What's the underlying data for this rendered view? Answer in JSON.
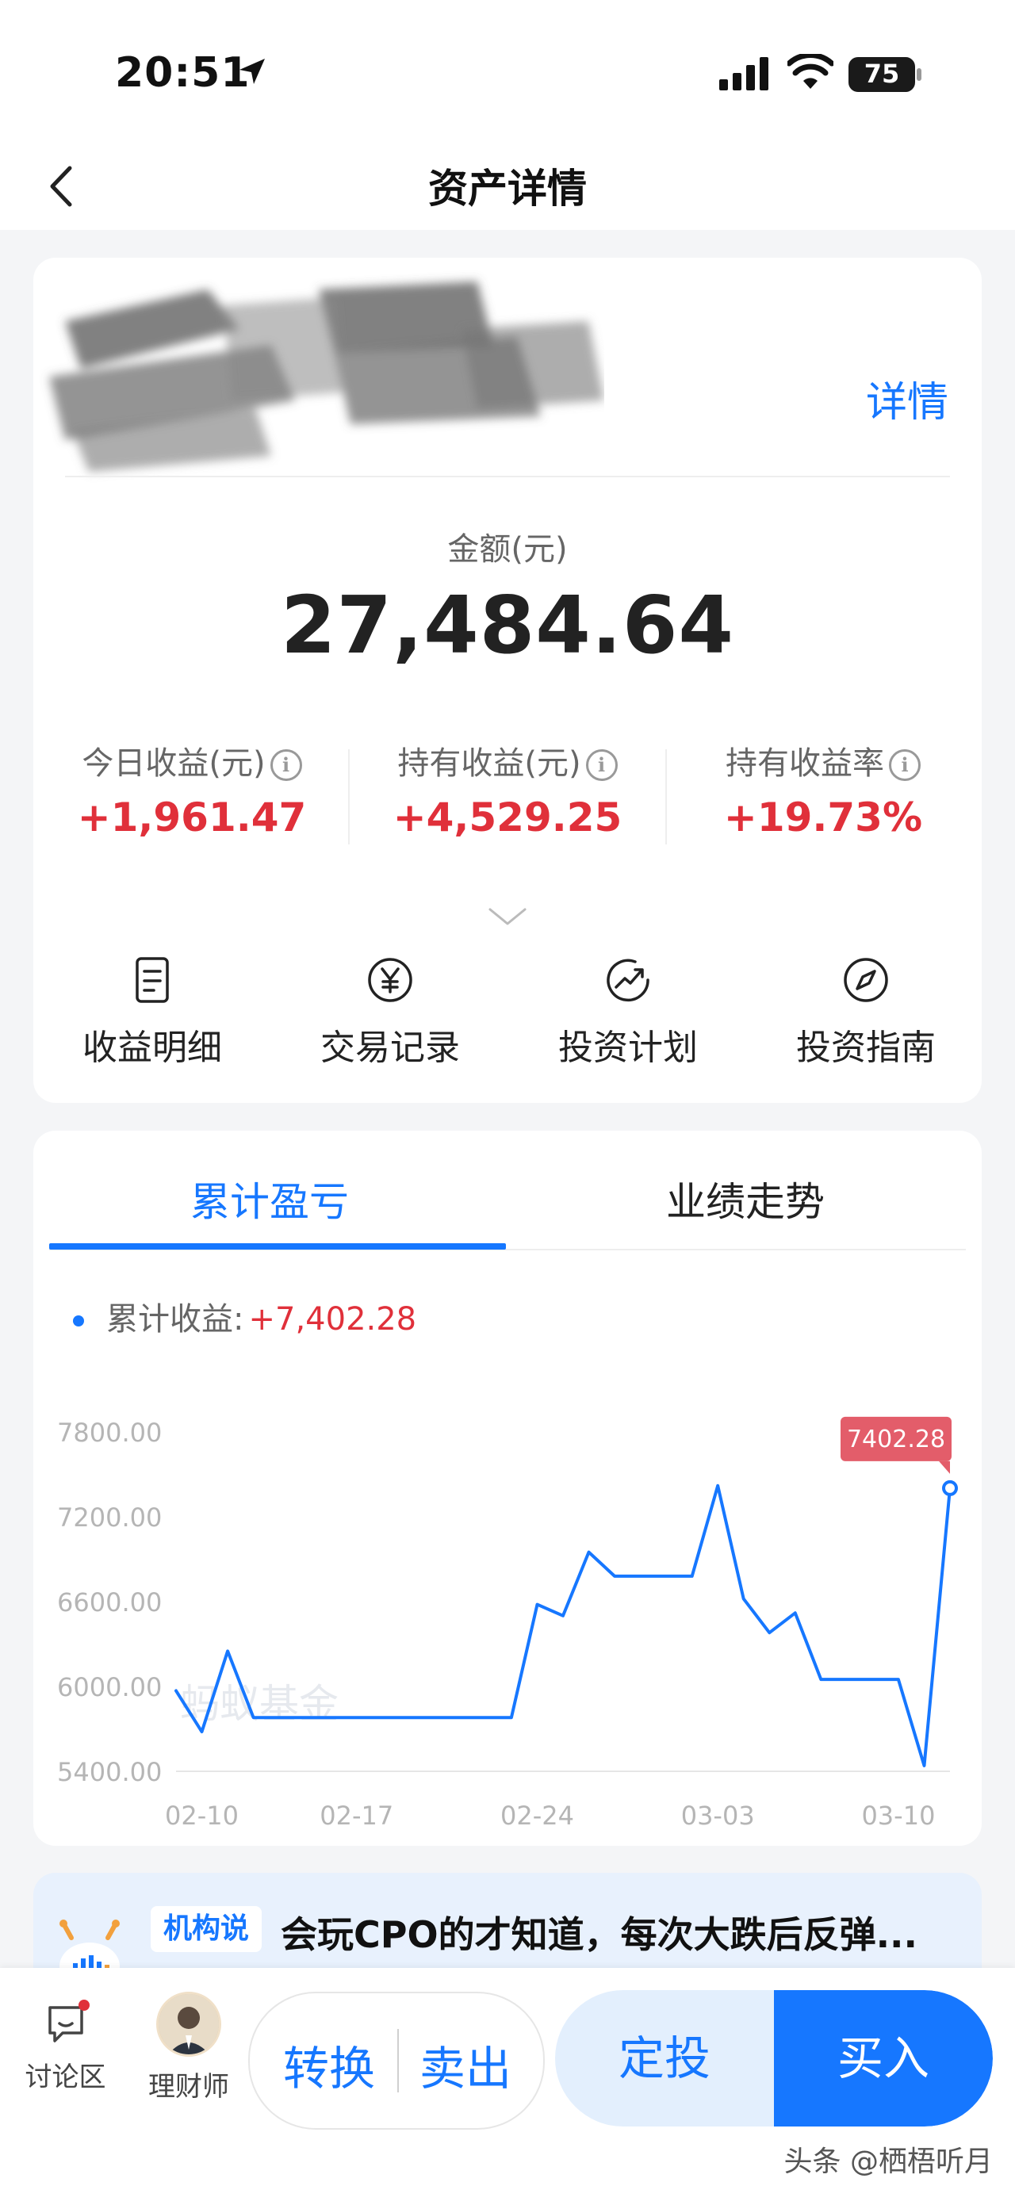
{
  "status_bar": {
    "time": "20:51",
    "battery": "75"
  },
  "nav": {
    "title": "资产详情",
    "back_icon": "chevron-left-icon"
  },
  "asset": {
    "detail_link": "详情",
    "amount_label": "金额(元)",
    "amount": "27,484.64",
    "stats": [
      {
        "label": "今日收益(元)",
        "value": "+1,961.47"
      },
      {
        "label": "持有收益(元)",
        "value": "+4,529.25"
      },
      {
        "label": "持有收益率",
        "value": "+19.73%"
      }
    ],
    "quick_actions": [
      {
        "label": "收益明细",
        "icon": "document-icon"
      },
      {
        "label": "交易记录",
        "icon": "yen-circle-icon"
      },
      {
        "label": "投资计划",
        "icon": "trend-circle-icon"
      },
      {
        "label": "投资指南",
        "icon": "compass-icon"
      }
    ]
  },
  "performance": {
    "tabs": [
      "累计盈亏",
      "业绩走势"
    ],
    "active_tab": 0,
    "legend_label": "累计收益:",
    "legend_value": "+7,402.28"
  },
  "chart_data": {
    "type": "line",
    "series": [
      {
        "values": [
          5970,
          5680,
          6250,
          5780,
          5780,
          5780,
          5780,
          5780,
          5780,
          5780,
          5780,
          5780,
          5780,
          5780,
          6580,
          6500,
          6950,
          6780,
          6780,
          6780,
          6780,
          7420,
          6620,
          6380,
          6520,
          6050,
          6050,
          6050,
          6050,
          5440,
          7402.28
        ]
      }
    ],
    "x_tick_labels": [
      "02-10",
      "02-17",
      "02-24",
      "03-03",
      "03-10"
    ],
    "y_tick_labels": [
      "7800.00",
      "7200.00",
      "6600.00",
      "6000.00",
      "5400.00"
    ],
    "ylim": [
      5400,
      7800
    ],
    "last_value_label": "7402.28",
    "watermark": "蚂蚁基金",
    "colors": {
      "line": "#1677ff",
      "tag": "#e35d6a"
    }
  },
  "institution": {
    "badge": "机构说",
    "title": "会玩CPO的才知道，每次大跌后反弹..."
  },
  "bottom_bar": {
    "discuss": "讨论区",
    "advisor": "理财师",
    "convert": "转换",
    "sell": "卖出",
    "auto_invest": "定投",
    "buy": "买入"
  },
  "watermark": "头条 @栖梧听月",
  "colors": {
    "accent": "#1677ff",
    "positive": "#e0303a"
  }
}
